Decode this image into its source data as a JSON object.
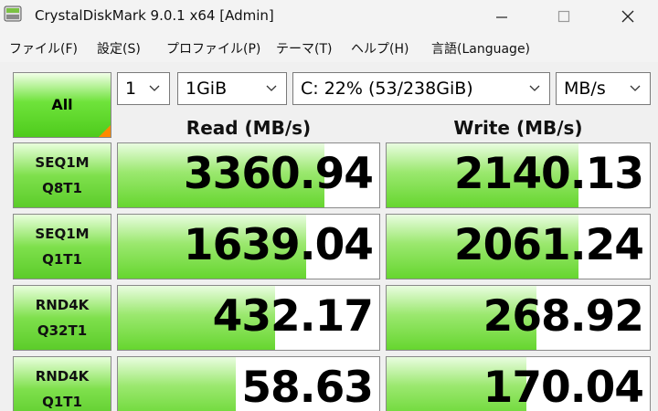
{
  "window": {
    "title": "CrystalDiskMark 9.0.1 x64 [Admin]"
  },
  "menu": [
    "ファイル(F)",
    "設定(S)",
    "プロファイル(P)",
    "テーマ(T)",
    "ヘルプ(H)",
    "言語(Language)"
  ],
  "controls": {
    "all_label": "All",
    "count": "1",
    "size": "1GiB",
    "drive": "C: 22% (53/238GiB)",
    "unit": "MB/s"
  },
  "headers": {
    "read": "Read (MB/s)",
    "write": "Write (MB/s)"
  },
  "tests": [
    {
      "line1": "SEQ1M",
      "line2": "Q8T1",
      "read": "3360.94",
      "write": "2140.13",
      "read_fill": 0.79,
      "write_fill": 0.73
    },
    {
      "line1": "SEQ1M",
      "line2": "Q1T1",
      "read": "1639.04",
      "write": "2061.24",
      "read_fill": 0.72,
      "write_fill": 0.73
    },
    {
      "line1": "RND4K",
      "line2": "Q32T1",
      "read": "432.17",
      "write": "268.92",
      "read_fill": 0.6,
      "write_fill": 0.57
    },
    {
      "line1": "RND4K",
      "line2": "Q1T1",
      "read": "58.63",
      "write": "170.04",
      "read_fill": 0.45,
      "write_fill": 0.53
    }
  ],
  "colors": {
    "bar_green": "#66d62f",
    "button_green": "#5ccc2a",
    "corner_orange": "#ff8a00"
  },
  "icons": [
    "app-disk-icon",
    "minimize-icon",
    "maximize-icon",
    "close-icon",
    "dropdown-arrow-icon"
  ]
}
